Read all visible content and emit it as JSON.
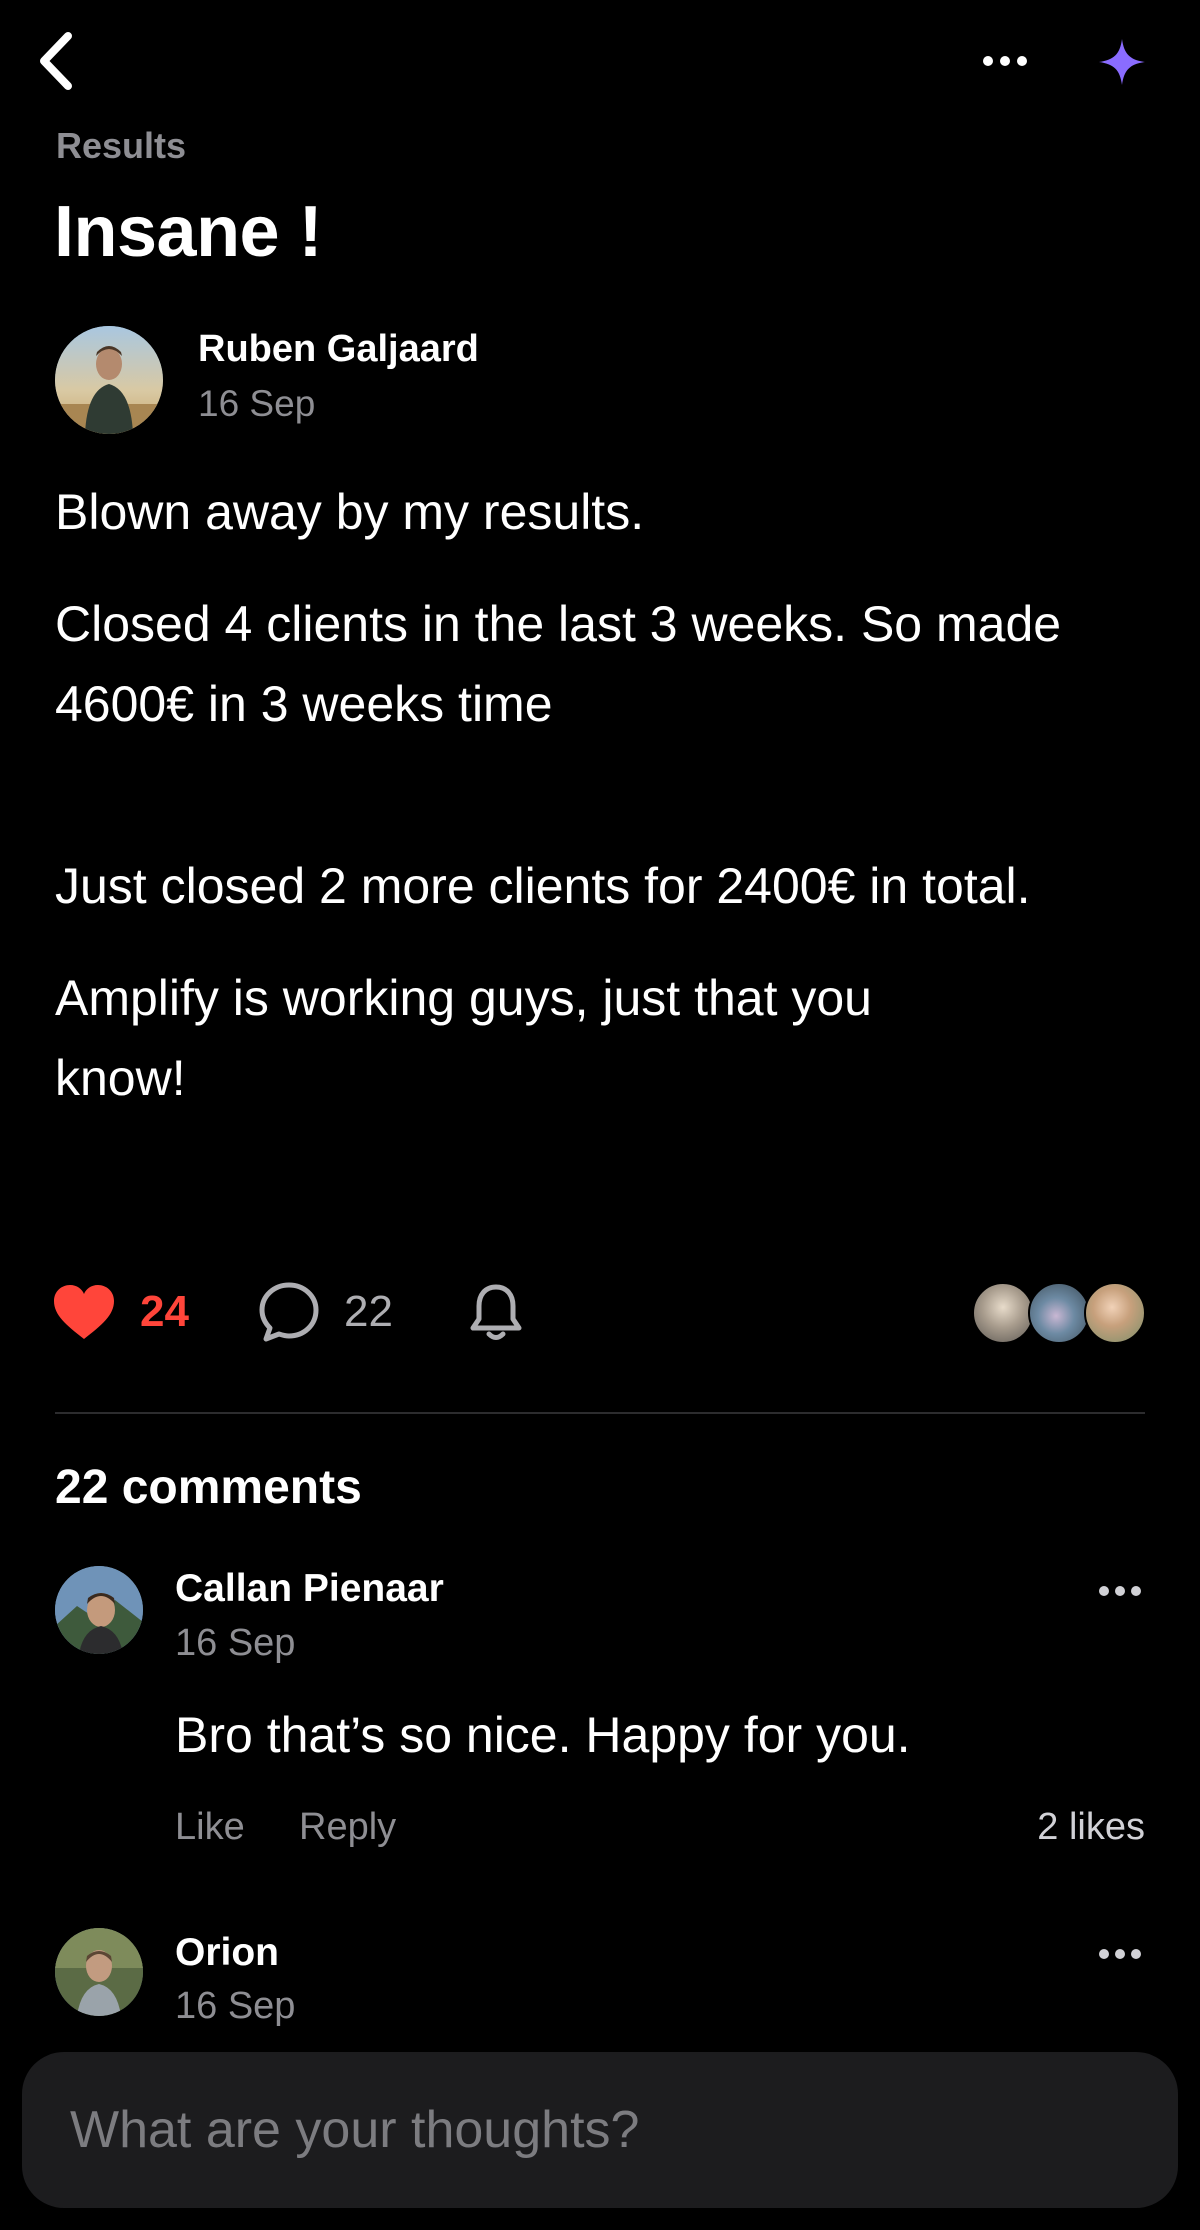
{
  "header": {
    "back_icon": "chevron-left-icon",
    "more_icon": "ellipsis-icon",
    "ai_icon": "sparkle-icon",
    "ai_icon_color": "#8a6cff"
  },
  "post": {
    "category": "Results",
    "title": "Insane !",
    "author": {
      "name": "Ruben Galjaard",
      "date": "16 Sep"
    },
    "body": [
      "Blown away by my results.",
      "Closed 4 clients in the last 3 weeks. So made 4600€ in 3 weeks time",
      "Just closed 2 more clients for 2400€ in total.",
      "Amplify is working guys, just that you know!"
    ],
    "likes": "24",
    "comments_count": "22",
    "like_color": "#ff453a"
  },
  "comments_section": {
    "heading": "22 comments",
    "items": [
      {
        "name": "Callan Pienaar",
        "date": "16 Sep",
        "text": "Bro that’s so nice. Happy for you.",
        "like_label": "Like",
        "reply_label": "Reply",
        "likes": "2 likes"
      },
      {
        "name": "Orion",
        "date": "16 Sep"
      }
    ]
  },
  "composer": {
    "placeholder": "What are your thoughts?"
  }
}
